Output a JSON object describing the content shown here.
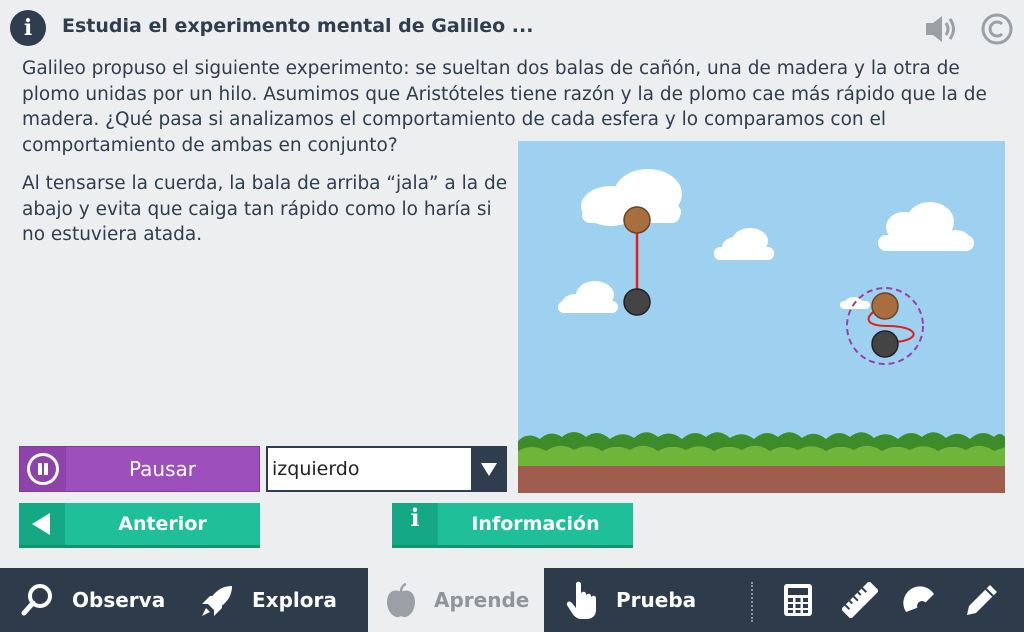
{
  "header": {
    "title": "Estudia el experimento mental de Galileo ...",
    "info_icon": "info-icon",
    "speaker_icon": "speaker-icon",
    "copyright_icon": "copyright-icon"
  },
  "content": {
    "intro": "Galileo propuso el siguiente experimento: se sueltan dos balas de cañón, una de madera y la otra de plomo unidas por un hilo. Asumimos que Aristóteles tiene razón y la de plomo cae más rápido que la de madera. ¿Qué pasa si analizamos el comportamiento de cada esfera y lo comparamos con el comportamiento de ambas en conjunto?",
    "explanation": "Al tensarse la cuerda, la bala de arriba “jala” a la de abajo y evita que caiga tan rápido como lo haría si no estuviera atada."
  },
  "controls": {
    "pause_label": "Pausar",
    "select_value": "izquierdo",
    "prev_label": "Anterior",
    "info_label": "Información"
  },
  "colors": {
    "nav_bg": "#2e3b4b",
    "accent_purple": "#9d4fbb",
    "accent_green": "#1fbf9a",
    "sky": "#9ed0ef",
    "ground": "#a05c4d",
    "wood_ball": "#a86e3f",
    "lead_ball": "#444444",
    "string": "#e02020"
  },
  "nav": {
    "items": [
      {
        "label": "Observa",
        "icon": "magnifier-icon"
      },
      {
        "label": "Explora",
        "icon": "rocket-icon"
      },
      {
        "label": "Aprende",
        "icon": "apple-icon",
        "active": true
      },
      {
        "label": "Prueba",
        "icon": "hand-pointer-icon"
      }
    ],
    "tools": [
      "calculator-icon",
      "ruler-icon",
      "protractor-icon",
      "pencil-icon"
    ]
  }
}
